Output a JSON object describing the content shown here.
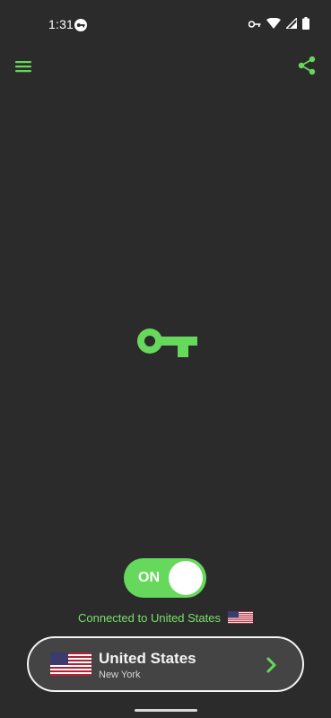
{
  "status_bar": {
    "time": "1:31"
  },
  "icons": {
    "menu": "hamburger-menu-icon",
    "share": "share-icon",
    "key": "key-icon",
    "chevron": "chevron-right-icon"
  },
  "toggle": {
    "label": "ON",
    "state": "on"
  },
  "connection": {
    "status_text": "Connected to United States"
  },
  "location": {
    "country": "United States",
    "city": "New York"
  },
  "colors": {
    "background": "#2b2b2b",
    "accent": "#66d95c",
    "card": "#444444"
  }
}
